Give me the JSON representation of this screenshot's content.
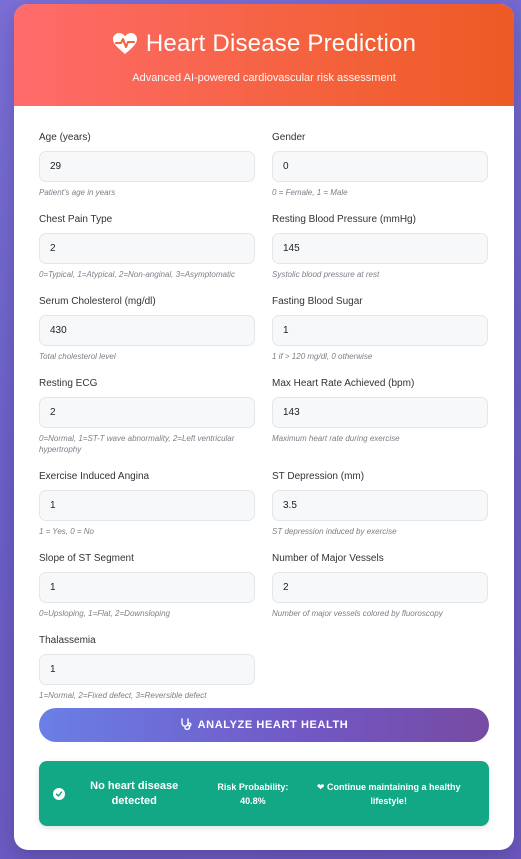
{
  "header": {
    "title": "Heart Disease Prediction",
    "subtitle": "Advanced AI-powered cardiovascular risk assessment",
    "icon": "heart-pulse-icon"
  },
  "fields": {
    "age": {
      "label": "Age (years)",
      "value": "29",
      "hint": "Patient's age in years"
    },
    "gender": {
      "label": "Gender",
      "value": "0",
      "hint": "0 = Female, 1 = Male"
    },
    "chest_pain": {
      "label": "Chest Pain Type",
      "value": "2",
      "hint": "0=Typical, 1=Atypical, 2=Non-anginal, 3=Asymptomatic"
    },
    "resting_bp": {
      "label": "Resting Blood Pressure (mmHg)",
      "value": "145",
      "hint": "Systolic blood pressure at rest"
    },
    "cholesterol": {
      "label": "Serum Cholesterol (mg/dl)",
      "value": "430",
      "hint": "Total cholesterol level"
    },
    "fasting_bs": {
      "label": "Fasting Blood Sugar",
      "value": "1",
      "hint": "1 if > 120 mg/dl, 0 otherwise"
    },
    "resting_ecg": {
      "label": "Resting ECG",
      "value": "2",
      "hint": "0=Normal, 1=ST-T wave abnormality, 2=Left ventricular hypertrophy"
    },
    "max_hr": {
      "label": "Max Heart Rate Achieved (bpm)",
      "value": "143",
      "hint": "Maximum heart rate during exercise"
    },
    "exercise_angina": {
      "label": "Exercise Induced Angina",
      "value": "1",
      "hint": "1 = Yes, 0 = No"
    },
    "st_depression": {
      "label": "ST Depression (mm)",
      "value": "3.5",
      "hint": "ST depression induced by exercise"
    },
    "slope": {
      "label": "Slope of ST Segment",
      "value": "1",
      "hint": "0=Upsloping, 1=Flat, 2=Downsloping"
    },
    "vessels": {
      "label": "Number of Major Vessels",
      "value": "2",
      "hint": "Number of major vessels colored by fluoroscopy"
    },
    "thalassemia": {
      "label": "Thalassemia",
      "value": "1",
      "hint": "1=Normal, 2=Fixed defect, 3=Reversible defect"
    }
  },
  "button": {
    "label": "ANALYZE HEART HEALTH",
    "icon": "stethoscope-icon"
  },
  "result": {
    "status": "No heart disease detected",
    "probability": "Risk Probability: 40.8%",
    "advice": "Continue maintaining a healthy lifestyle!",
    "icon": "check-circle-icon",
    "advice_icon": "heart-icon",
    "color": "#13a885"
  },
  "colors": {
    "header_start": "#ff6b6b",
    "header_end": "#ee5a24",
    "button_start": "#6a7fe6",
    "button_end": "#764ba2",
    "background": "#6a5fc8"
  }
}
